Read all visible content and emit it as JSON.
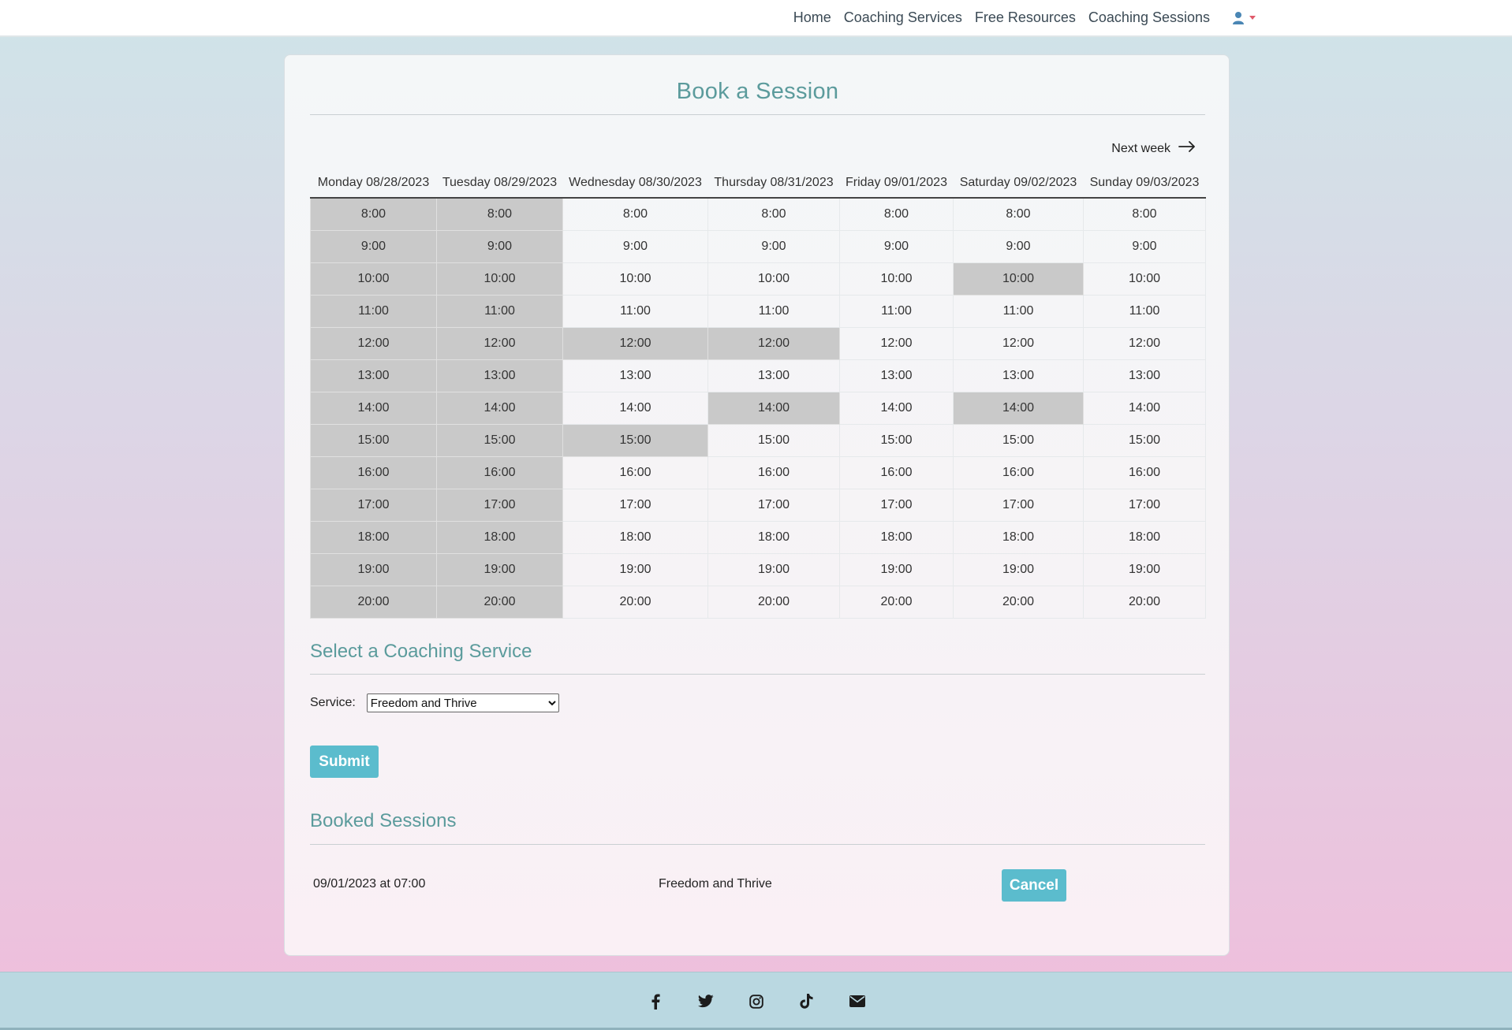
{
  "nav": {
    "links": [
      "Home",
      "Coaching Services",
      "Free Resources",
      "Coaching Sessions"
    ],
    "user_icon": "user-icon",
    "dropdown_icon": "caret-down-icon"
  },
  "page": {
    "title": "Book a Session",
    "next_week_label": "Next week",
    "next_week_icon": "arrow-right-icon"
  },
  "schedule": {
    "days": [
      "Monday 08/28/2023",
      "Tuesday 08/29/2023",
      "Wednesday 08/30/2023",
      "Thursday 08/31/2023",
      "Friday 09/01/2023",
      "Saturday 09/02/2023",
      "Sunday 09/03/2023"
    ],
    "times": [
      "8:00",
      "9:00",
      "10:00",
      "11:00",
      "12:00",
      "13:00",
      "14:00",
      "15:00",
      "16:00",
      "17:00",
      "18:00",
      "19:00",
      "20:00"
    ],
    "unavailable": {
      "Monday 08/28/2023": [
        "8:00",
        "9:00",
        "10:00",
        "11:00",
        "12:00",
        "13:00",
        "14:00",
        "15:00",
        "16:00",
        "17:00",
        "18:00",
        "19:00",
        "20:00"
      ],
      "Tuesday 08/29/2023": [
        "8:00",
        "9:00",
        "10:00",
        "11:00",
        "12:00",
        "13:00",
        "14:00",
        "15:00",
        "16:00",
        "17:00",
        "18:00",
        "19:00",
        "20:00"
      ],
      "Wednesday 08/30/2023": [
        "12:00",
        "15:00"
      ],
      "Thursday 08/31/2023": [
        "12:00",
        "14:00"
      ],
      "Friday 09/01/2023": [],
      "Saturday 09/02/2023": [
        "10:00",
        "14:00"
      ],
      "Sunday 09/03/2023": []
    },
    "colors": {
      "unavailable": "#c9c9c9",
      "available": "transparent"
    }
  },
  "service_section": {
    "title": "Select a Coaching Service",
    "label": "Service:",
    "selected": "Freedom and Thrive",
    "submit_label": "Submit"
  },
  "booked_section": {
    "title": "Booked Sessions",
    "items": [
      {
        "date": "09/01/2023 at 07:00",
        "service": "Freedom and Thrive",
        "cancel_label": "Cancel"
      }
    ]
  },
  "footer": {
    "icons": [
      "facebook-icon",
      "twitter-icon",
      "instagram-icon",
      "tiktok-icon",
      "envelope-icon"
    ]
  },
  "colors": {
    "accent": "#5b9b9c",
    "button": "#5bbccd",
    "footer": "#bad8e1"
  }
}
